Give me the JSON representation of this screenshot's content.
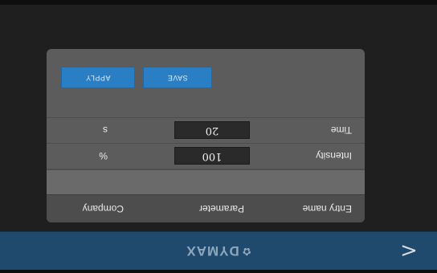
{
  "header": {
    "brand": "DYMAX",
    "brand_mark": "✿",
    "back_glyph": "<"
  },
  "table": {
    "columns": {
      "entry_name": "Entry name",
      "parameter": "Parameter",
      "company": "Company"
    },
    "rows": [
      {
        "label": "Intensity",
        "value": "100",
        "unit": "%"
      },
      {
        "label": "Time",
        "value": "20",
        "unit": "s"
      }
    ]
  },
  "buttons": {
    "save": "SAVE",
    "apply": "APPLY"
  },
  "display": {
    "orientation": "rotated 180 degrees",
    "header_color": "#1f4a6e",
    "button_color": "#2a7fc4"
  }
}
